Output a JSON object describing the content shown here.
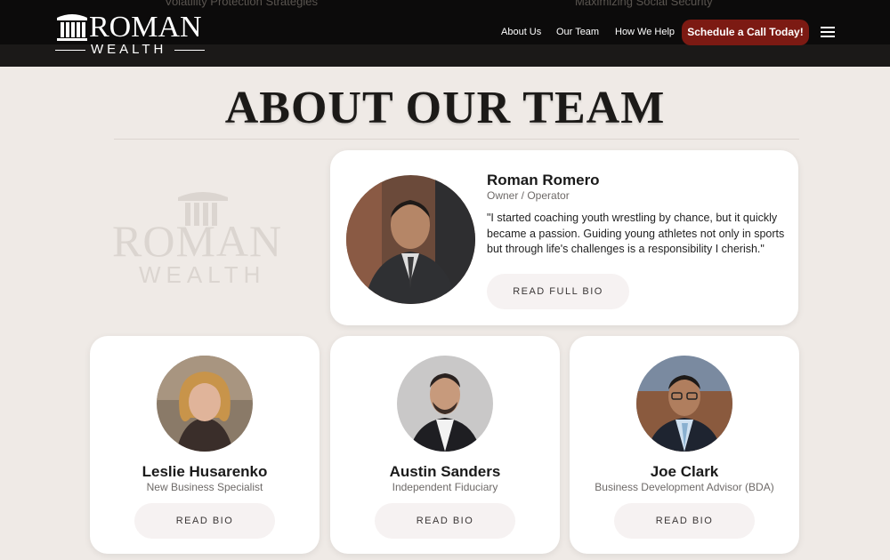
{
  "header": {
    "ghost_left": "Volatility Protection Strategies",
    "ghost_right": "Maximizing Social Security",
    "logo_main": "ROMAN",
    "logo_sub": "WEALTH",
    "nav": [
      "About Us",
      "Our Team",
      "How We Help"
    ],
    "cta_label": "Schedule a Call Today!"
  },
  "page": {
    "title": "ABOUT OUR TEAM",
    "watermark_main": "ROMAN",
    "watermark_sub": "WEALTH"
  },
  "featured": {
    "name": "Roman Romero",
    "role": "Owner / Operator",
    "quote": "\"I started coaching youth wrestling by chance, but it quickly became a passion. Guiding young athletes not only in sports but through life's challenges is a responsibility I cherish.\"",
    "button": "READ FULL BIO"
  },
  "team": [
    {
      "name": "Leslie Husarenko",
      "role": "New Business Specialist",
      "button": "READ BIO"
    },
    {
      "name": "Austin Sanders",
      "role": "Independent Fiduciary",
      "button": "READ BIO"
    },
    {
      "name": "Joe Clark",
      "role": "Business Development Advisor (BDA)",
      "button": "READ BIO"
    }
  ],
  "colors": {
    "header_bg": "#0c0b0b",
    "cta_bg": "#7c1a13",
    "page_bg": "#efeae6"
  }
}
